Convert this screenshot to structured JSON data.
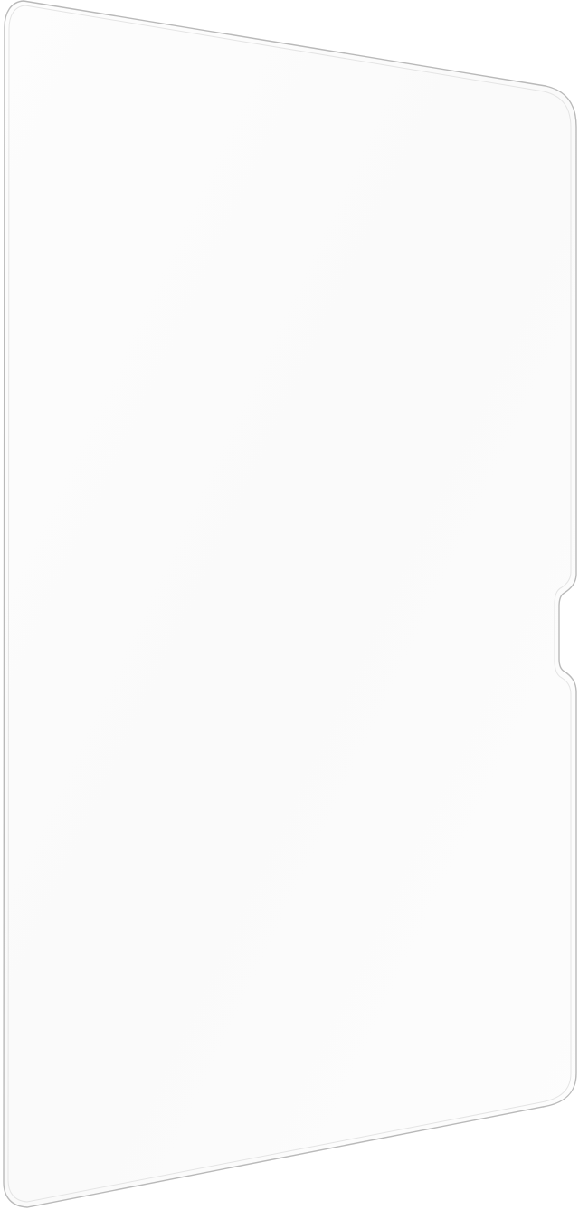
{
  "image": {
    "subject": "screen-protector",
    "colors": {
      "background": "#ffffff",
      "glass_fill": "#fcfcfc",
      "outline": "#b9b9b9",
      "inner_edge": "#e4e4e4"
    }
  }
}
